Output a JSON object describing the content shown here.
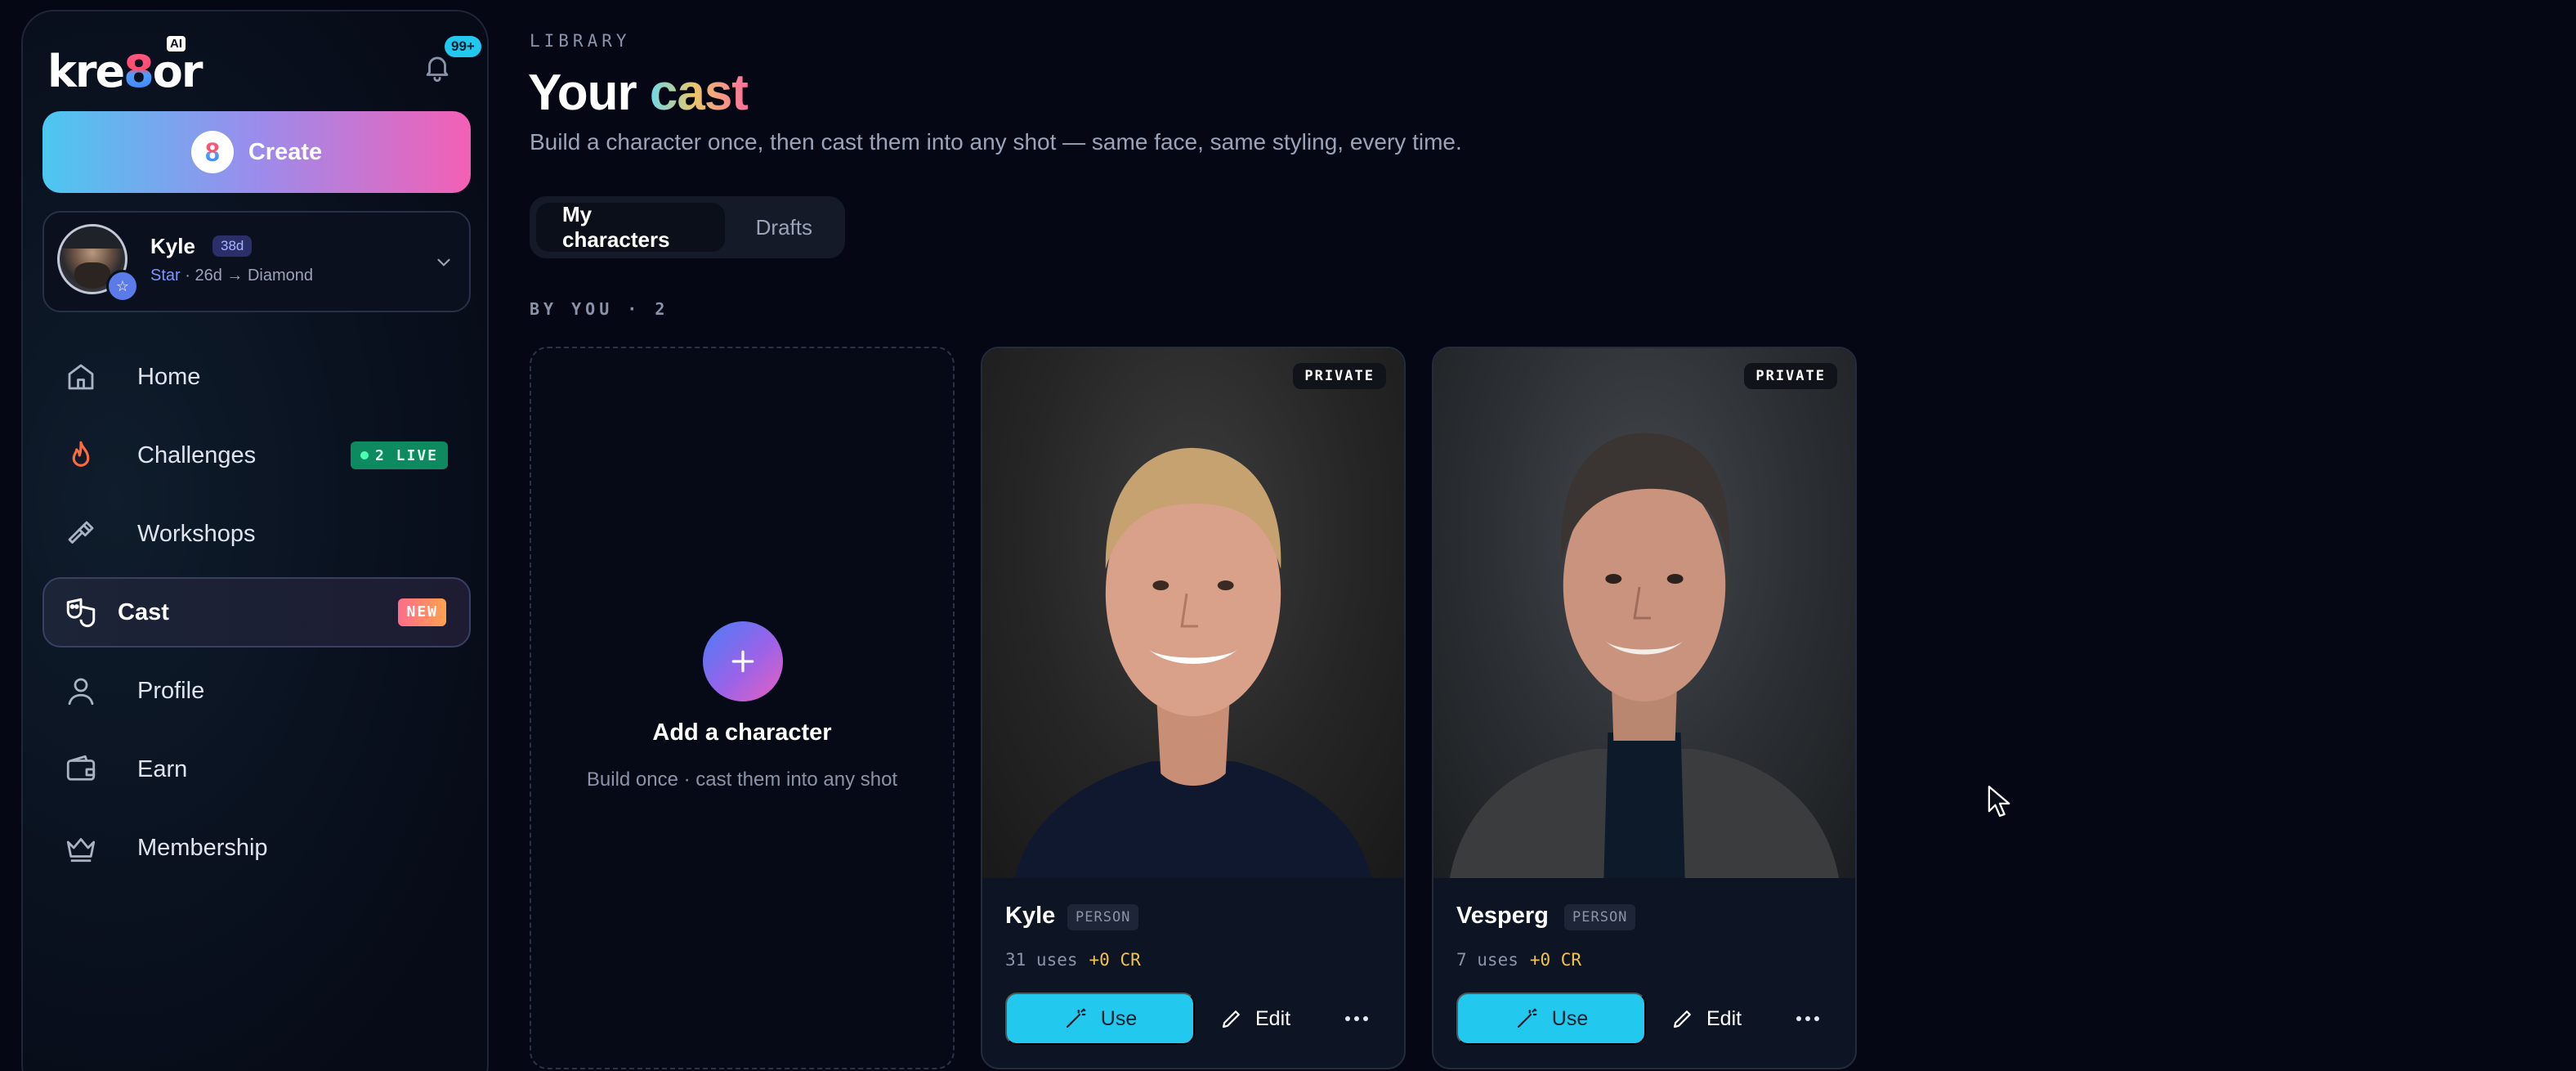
{
  "brand": {
    "logo_text_pre": "kre",
    "logo_text_mid": "8",
    "logo_text_post": "or",
    "ai_tag": "AI"
  },
  "notifications": {
    "count": "99+"
  },
  "sidebar": {
    "create_label": "Create",
    "create_icon_glyph": "8",
    "user": {
      "name": "Kyle",
      "days_badge": "38d",
      "tier": "Star",
      "progress_text": " · 26d → Diamond"
    },
    "items": [
      {
        "label": "Home",
        "icon": "home-icon"
      },
      {
        "label": "Challenges",
        "icon": "flame-icon",
        "badge": "2 LIVE"
      },
      {
        "label": "Workshops",
        "icon": "hammer-icon"
      },
      {
        "label": "Cast",
        "icon": "masks-icon",
        "badge": "NEW",
        "active": true
      },
      {
        "label": "Profile",
        "icon": "person-icon"
      },
      {
        "label": "Earn",
        "icon": "wallet-icon"
      },
      {
        "label": "Membership",
        "icon": "crown-icon"
      }
    ]
  },
  "main": {
    "eyebrow": "LIBRARY",
    "title_pre": "Your ",
    "title_accent": "cast",
    "subtitle": "Build a character once, then cast them into any shot — same face, same styling, every time.",
    "tabs": [
      {
        "label": "My characters",
        "active": true
      },
      {
        "label": "Drafts",
        "active": false
      }
    ],
    "section_label": "BY YOU · 2",
    "add_card": {
      "title": "Add a character",
      "subtitle": "Build once · cast them into any shot"
    },
    "characters": [
      {
        "name": "Kyle",
        "kind": "PERSON",
        "visibility": "PRIVATE",
        "uses": "31 uses",
        "credits": "+0 CR",
        "use_label": "Use",
        "edit_label": "Edit"
      },
      {
        "name": "Vesperg",
        "kind": "PERSON",
        "visibility": "PRIVATE",
        "uses": "7 uses",
        "credits": "+0 CR",
        "use_label": "Use",
        "edit_label": "Edit"
      }
    ]
  },
  "colors": {
    "background": "#050814",
    "accent_cyan": "#22c8ee",
    "live_green": "#0d8a5f",
    "credit_gold": "#f2c44a"
  }
}
